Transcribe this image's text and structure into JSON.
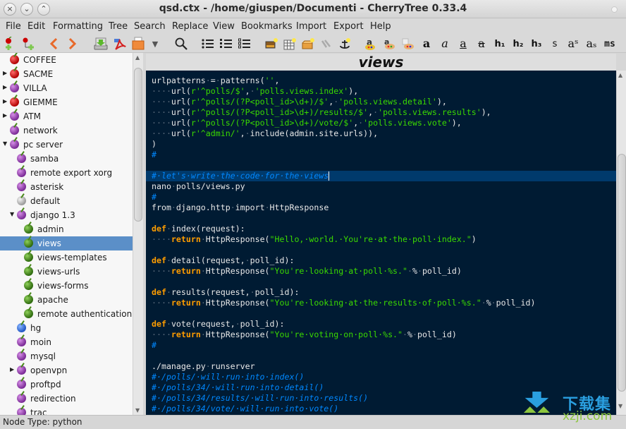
{
  "window": {
    "title": "qsd.ctx - /home/giuspen/Documenti - CherryTree 0.33.4",
    "buttons": {
      "close": "×",
      "minimize": "⌄",
      "maximize": "⌃"
    }
  },
  "menu": [
    "File",
    "Edit",
    "Formatting",
    "Tree",
    "Search",
    "Replace",
    "View",
    "Bookmarks",
    "Import",
    "Export",
    "Help"
  ],
  "toolbar": {
    "tools": [
      {
        "name": "add-node",
        "glyph": "🍒"
      },
      {
        "name": "add-subnode",
        "glyph": "🍒"
      },
      {
        "name": "go-back",
        "glyph": "❮"
      },
      {
        "name": "go-forward",
        "glyph": "❯"
      },
      {
        "name": "save",
        "glyph": "⬇"
      },
      {
        "name": "export-pdf",
        "glyph": "PDF"
      },
      {
        "name": "open-folder",
        "glyph": "📂"
      },
      {
        "name": "dropdown",
        "glyph": "▾"
      },
      {
        "name": "find",
        "glyph": "🔍"
      },
      {
        "name": "bulleted-list",
        "glyph": "☰"
      },
      {
        "name": "numbered-list",
        "glyph": "☰"
      },
      {
        "name": "todo-list",
        "glyph": "☰"
      },
      {
        "name": "insert-image",
        "glyph": "▣"
      },
      {
        "name": "insert-table",
        "glyph": "▦"
      },
      {
        "name": "insert-codebox",
        "glyph": "📦"
      },
      {
        "name": "insert-link",
        "glyph": "🔗"
      },
      {
        "name": "insert-anchor",
        "glyph": "⚓"
      },
      {
        "name": "text-color",
        "glyph": "🎨"
      },
      {
        "name": "background-color",
        "glyph": "🎨"
      },
      {
        "name": "remove-formatting",
        "glyph": "🎨"
      }
    ],
    "format": [
      "a",
      "a",
      "a",
      "a",
      "h₁",
      "h₂",
      "h₃",
      "s",
      "aˢ",
      "aₛ",
      "ms"
    ]
  },
  "tree": {
    "nodes": [
      {
        "label": "COFFEE",
        "color": "red",
        "level": 0,
        "expander": ""
      },
      {
        "label": "SACME",
        "color": "red",
        "level": 0,
        "expander": "▶"
      },
      {
        "label": "VILLA",
        "color": "purple",
        "level": 0,
        "expander": "▶"
      },
      {
        "label": "GIEMME",
        "color": "red",
        "level": 0,
        "expander": "▶"
      },
      {
        "label": "ATM",
        "color": "purple",
        "level": 0,
        "expander": "▶"
      },
      {
        "label": "network",
        "color": "purple",
        "level": 0,
        "expander": ""
      },
      {
        "label": "pc server",
        "color": "purple",
        "level": 0,
        "expander": "▼"
      },
      {
        "label": "samba",
        "color": "purple",
        "level": 1,
        "expander": ""
      },
      {
        "label": "remote export xorg",
        "color": "purple",
        "level": 1,
        "expander": ""
      },
      {
        "label": "asterisk",
        "color": "purple",
        "level": 1,
        "expander": ""
      },
      {
        "label": "default",
        "color": "gray",
        "level": 1,
        "expander": ""
      },
      {
        "label": "django 1.3",
        "color": "purple",
        "level": 1,
        "expander": "▼"
      },
      {
        "label": "admin",
        "color": "green",
        "level": 2,
        "expander": ""
      },
      {
        "label": "views",
        "color": "green",
        "level": 2,
        "expander": "",
        "selected": true
      },
      {
        "label": "views-templates",
        "color": "green",
        "level": 2,
        "expander": ""
      },
      {
        "label": "views-urls",
        "color": "green",
        "level": 2,
        "expander": ""
      },
      {
        "label": "views-forms",
        "color": "green",
        "level": 2,
        "expander": ""
      },
      {
        "label": "apache",
        "color": "green",
        "level": 2,
        "expander": ""
      },
      {
        "label": "remote authentication",
        "color": "green",
        "level": 2,
        "expander": ""
      },
      {
        "label": "hg",
        "color": "blue",
        "level": 1,
        "expander": ""
      },
      {
        "label": "moin",
        "color": "purple",
        "level": 1,
        "expander": ""
      },
      {
        "label": "mysql",
        "color": "purple",
        "level": 1,
        "expander": ""
      },
      {
        "label": "openvpn",
        "color": "purple",
        "level": 1,
        "expander": "▶"
      },
      {
        "label": "proftpd",
        "color": "purple",
        "level": 1,
        "expander": ""
      },
      {
        "label": "redirection",
        "color": "purple",
        "level": 1,
        "expander": ""
      },
      {
        "label": "trac",
        "color": "purple",
        "level": 1,
        "expander": ""
      }
    ]
  },
  "editor": {
    "node_title": "views",
    "lines": [
      [
        [
          "t",
          "urlpatterns"
        ],
        [
          "w",
          "·"
        ],
        [
          "t",
          "="
        ],
        [
          "w",
          "·"
        ],
        [
          "t",
          "patterns("
        ],
        [
          "s",
          "''"
        ],
        [
          "t",
          ","
        ]
      ],
      [
        [
          "w",
          "····"
        ],
        [
          "t",
          "url("
        ],
        [
          "s",
          "r'^polls/$'"
        ],
        [
          "t",
          ","
        ],
        [
          "w",
          "·"
        ],
        [
          "s",
          "'polls.views.index'"
        ],
        [
          "t",
          "),"
        ]
      ],
      [
        [
          "w",
          "····"
        ],
        [
          "t",
          "url("
        ],
        [
          "s",
          "r'^polls/(?P<poll_id>\\d+)/$'"
        ],
        [
          "t",
          ","
        ],
        [
          "w",
          "·"
        ],
        [
          "s",
          "'polls.views.detail'"
        ],
        [
          "t",
          "),"
        ]
      ],
      [
        [
          "w",
          "····"
        ],
        [
          "t",
          "url("
        ],
        [
          "s",
          "r'^polls/(?P<poll_id>\\d+)/results/$'"
        ],
        [
          "t",
          ","
        ],
        [
          "w",
          "·"
        ],
        [
          "s",
          "'polls.views.results'"
        ],
        [
          "t",
          "),"
        ]
      ],
      [
        [
          "w",
          "····"
        ],
        [
          "t",
          "url("
        ],
        [
          "s",
          "r'^polls/(?P<poll_id>\\d+)/vote/$'"
        ],
        [
          "t",
          ","
        ],
        [
          "w",
          "·"
        ],
        [
          "s",
          "'polls.views.vote'"
        ],
        [
          "t",
          "),"
        ]
      ],
      [
        [
          "w",
          "····"
        ],
        [
          "t",
          "url("
        ],
        [
          "s",
          "r'^admin/'"
        ],
        [
          "t",
          ","
        ],
        [
          "w",
          "·"
        ],
        [
          "t",
          "include(admin.site.urls)),"
        ]
      ],
      [
        [
          "t",
          ")"
        ]
      ],
      [
        [
          "h",
          "#"
        ]
      ],
      [],
      [
        [
          "c",
          "#·let's·write·the·code·for·the·views"
        ],
        [
          "caret",
          ""
        ]
      ],
      [
        [
          "t",
          "nano"
        ],
        [
          "w",
          "·"
        ],
        [
          "t",
          "polls/views.py"
        ]
      ],
      [
        [
          "h",
          "#"
        ]
      ],
      [
        [
          "t",
          "from"
        ],
        [
          "w",
          "·"
        ],
        [
          "t",
          "django.http"
        ],
        [
          "w",
          "·"
        ],
        [
          "t",
          "import"
        ],
        [
          "w",
          "·"
        ],
        [
          "t",
          "HttpResponse"
        ]
      ],
      [],
      [
        [
          "k",
          "def"
        ],
        [
          "w",
          "·"
        ],
        [
          "t",
          "index(request):"
        ]
      ],
      [
        [
          "w",
          "····"
        ],
        [
          "k",
          "return"
        ],
        [
          "w",
          "·"
        ],
        [
          "t",
          "HttpResponse("
        ],
        [
          "s",
          "\"Hello,·world.·You're·at·the·poll·index.\""
        ],
        [
          "t",
          ")"
        ]
      ],
      [],
      [
        [
          "k",
          "def"
        ],
        [
          "w",
          "·"
        ],
        [
          "t",
          "detail(request,"
        ],
        [
          "w",
          "·"
        ],
        [
          "t",
          "poll_id):"
        ]
      ],
      [
        [
          "w",
          "····"
        ],
        [
          "k",
          "return"
        ],
        [
          "w",
          "·"
        ],
        [
          "t",
          "HttpResponse("
        ],
        [
          "s",
          "\"You're·looking·at·poll·%s.\""
        ],
        [
          "w",
          "·"
        ],
        [
          "t",
          "%"
        ],
        [
          "w",
          "·"
        ],
        [
          "t",
          "poll_id)"
        ]
      ],
      [],
      [
        [
          "k",
          "def"
        ],
        [
          "w",
          "·"
        ],
        [
          "t",
          "results(request,"
        ],
        [
          "w",
          "·"
        ],
        [
          "t",
          "poll_id):"
        ]
      ],
      [
        [
          "w",
          "····"
        ],
        [
          "k",
          "return"
        ],
        [
          "w",
          "·"
        ],
        [
          "t",
          "HttpResponse("
        ],
        [
          "s",
          "\"You're·looking·at·the·results·of·poll·%s.\""
        ],
        [
          "w",
          "·"
        ],
        [
          "t",
          "%"
        ],
        [
          "w",
          "·"
        ],
        [
          "t",
          "poll_id)"
        ]
      ],
      [],
      [
        [
          "k",
          "def"
        ],
        [
          "w",
          "·"
        ],
        [
          "t",
          "vote(request,"
        ],
        [
          "w",
          "·"
        ],
        [
          "t",
          "poll_id):"
        ]
      ],
      [
        [
          "w",
          "····"
        ],
        [
          "k",
          "return"
        ],
        [
          "w",
          "·"
        ],
        [
          "t",
          "HttpResponse("
        ],
        [
          "s",
          "\"You're·voting·on·poll·%s.\""
        ],
        [
          "w",
          "·"
        ],
        [
          "t",
          "%"
        ],
        [
          "w",
          "·"
        ],
        [
          "t",
          "poll_id)"
        ]
      ],
      [
        [
          "h",
          "#"
        ]
      ],
      [],
      [
        [
          "t",
          "./manage.py"
        ],
        [
          "w",
          "·"
        ],
        [
          "t",
          "runserver"
        ]
      ],
      [
        [
          "c",
          "#·/polls/·will·run·into·index()"
        ]
      ],
      [
        [
          "c",
          "#·/polls/34/·will·run·into·detail()"
        ]
      ],
      [
        [
          "c",
          "#·/polls/34/results/·will·run·into·results()"
        ]
      ],
      [
        [
          "c",
          "#·/polls/34/vote/·will·run·into·vote()"
        ]
      ]
    ],
    "highlighted_line": 9
  },
  "status": {
    "text": "Node Type: python"
  },
  "watermark": {
    "cn": "下载集",
    "en": "xzji.com"
  },
  "colors": {
    "editor_bg": "#001b33",
    "string": "#3ad900",
    "keyword": "#ff9d00",
    "comment": "#0088ff",
    "selection": "#5b8fc8"
  }
}
